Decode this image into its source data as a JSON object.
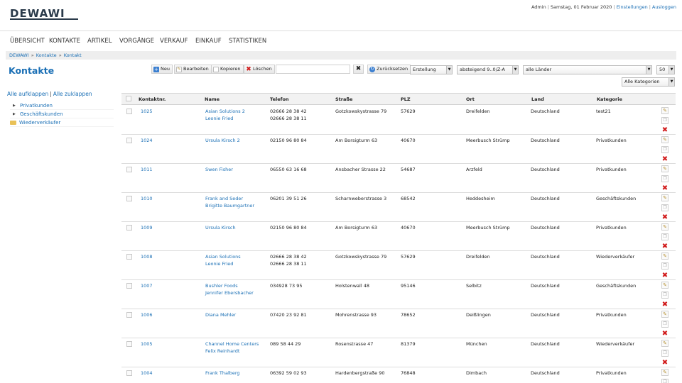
{
  "header": {
    "logo": "DEWAWI",
    "user": "Admin",
    "date": "Samstag, 01 Februar 2020",
    "settings_link": "Einstellungen",
    "logout_link": "Ausloggen"
  },
  "nav": [
    "ÜBERSICHT",
    "KONTAKTE",
    "ARTIKEL",
    "VORGÄNGE",
    "VERKAUF",
    "EINKAUF",
    "STATISTIKEN"
  ],
  "breadcrumb": [
    "DEWAWI",
    "Kontakte",
    "Kontakt"
  ],
  "page_title": "Kontakte",
  "toolbar": {
    "new": "Neu",
    "edit": "Bearbeiten",
    "copy": "Kopieren",
    "delete": "Löschen",
    "search_value": "",
    "reset": "Zurücksetzen",
    "sort_field": "Erstellung",
    "sort_order": "absteigend 9..0/Z-A",
    "country": "alle Länder",
    "per_page": "50",
    "category": "Alle Kategorien"
  },
  "sidebar": {
    "expand_all": "Alle aufklappen",
    "collapse_all": "Alle zuklappen",
    "items": [
      "Privatkunden",
      "Geschäftskunden",
      "Wiederverkäufer"
    ]
  },
  "table": {
    "columns": [
      "Kontaktnr.",
      "Name",
      "Telefon",
      "Straße",
      "PLZ",
      "Ort",
      "Land",
      "Kategorie"
    ],
    "rows": [
      {
        "nr": "1025",
        "name": [
          "Asian Solutions 2",
          "Leonie Fried"
        ],
        "phone": [
          "02666 28 38 42",
          "02666 28 38 11"
        ],
        "street": "Gotzkowskystrasse 79",
        "plz": "57629",
        "ort": "Dreifelden",
        "land": "Deutschland",
        "kategorie": "test21"
      },
      {
        "nr": "1024",
        "name": [
          "Ursula Kirsch 2"
        ],
        "phone": [
          "02150 96 80 84"
        ],
        "street": "Am Borsigturm 63",
        "plz": "40670",
        "ort": "Meerbusch Strümp",
        "land": "Deutschland",
        "kategorie": "Privatkunden"
      },
      {
        "nr": "1011",
        "name": [
          "Swen Fisher"
        ],
        "phone": [
          "06550 63 16 68"
        ],
        "street": "Ansbacher Strasse 22",
        "plz": "54687",
        "ort": "Arzfeld",
        "land": "Deutschland",
        "kategorie": "Privatkunden"
      },
      {
        "nr": "1010",
        "name": [
          "Frank and Seder",
          "Brigitte Baumgartner"
        ],
        "phone": [
          "06201 39 51 26"
        ],
        "street": "Scharnweberstrasse 3",
        "plz": "68542",
        "ort": "Heddesheim",
        "land": "Deutschland",
        "kategorie": "Geschäftskunden"
      },
      {
        "nr": "1009",
        "name": [
          "Ursula Kirsch"
        ],
        "phone": [
          "02150 96 80 84"
        ],
        "street": "Am Borsigturm 63",
        "plz": "40670",
        "ort": "Meerbusch Strümp",
        "land": "Deutschland",
        "kategorie": "Privatkunden"
      },
      {
        "nr": "1008",
        "name": [
          "Asian Solutions",
          "Leonie Fried"
        ],
        "phone": [
          "02666 28 38 42",
          "02666 28 38 11"
        ],
        "street": "Gotzkowskystrasse 79",
        "plz": "57629",
        "ort": "Dreifelden",
        "land": "Deutschland",
        "kategorie": "Wiederverkäufer"
      },
      {
        "nr": "1007",
        "name": [
          "Bushler Foods",
          "Jennifer Ebersbacher"
        ],
        "phone": [
          "034928 73 95"
        ],
        "street": "Holstenwall 48",
        "plz": "95146",
        "ort": "Selbitz",
        "land": "Deutschland",
        "kategorie": "Geschäftskunden"
      },
      {
        "nr": "1006",
        "name": [
          "Diana Mehler"
        ],
        "phone": [
          "07420 23 92 81"
        ],
        "street": "Mohrenstrasse 93",
        "plz": "78652",
        "ort": "Deißlingen",
        "land": "Deutschland",
        "kategorie": "Privatkunden"
      },
      {
        "nr": "1005",
        "name": [
          "Channel Home Centers",
          "Felix Reinhardt"
        ],
        "phone": [
          "089 58 44 29"
        ],
        "street": "Rosenstrasse 47",
        "plz": "81379",
        "ort": "München",
        "land": "Deutschland",
        "kategorie": "Wiederverkäufer"
      },
      {
        "nr": "1004",
        "name": [
          "Frank Thalberg"
        ],
        "phone": [
          "06392 59 02 93"
        ],
        "street": "Hardenbergstraße 90",
        "plz": "76848",
        "ort": "Dimbach",
        "land": "Deutschland",
        "kategorie": "Privatkunden"
      }
    ]
  },
  "colors": {
    "link": "#1a6fb5",
    "brand": "#2a3a4a",
    "delete": "#d11a1a"
  }
}
